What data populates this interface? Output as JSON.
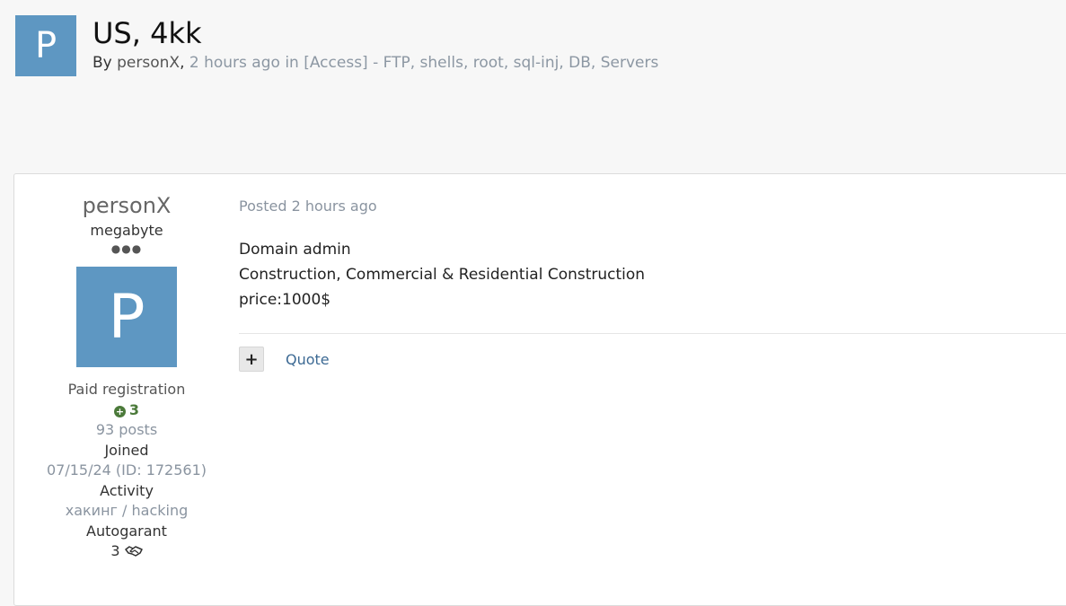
{
  "topic": {
    "avatar_letter": "P",
    "title": "US, 4kk",
    "by_label": "By",
    "author": "personX",
    "separator": ",",
    "time": "2 hours ago",
    "in_label": "in",
    "forum": "[Access] - FTP, shells, root, sql-inj, DB, Servers"
  },
  "author_panel": {
    "name": "personX",
    "rank": "megabyte",
    "rank_dots": "●●●",
    "avatar_letter": "P",
    "group": "Paid registration",
    "reputation": "3",
    "posts": "93 posts",
    "joined_label": "Joined",
    "joined_value": "07/15/24 (ID: 172561)",
    "activity_label": "Activity",
    "activity_value": "хакинг / hacking",
    "autogarant_label": "Autogarant",
    "autogarant_value": "3"
  },
  "post": {
    "posted": "Posted 2 hours ago",
    "lines": [
      "Domain admin",
      "Construction, Commercial & Residential Construction",
      "price:1000$"
    ],
    "plus_label": "+",
    "quote_label": "Quote"
  },
  "icons": {
    "reputation": "plus-circle-icon",
    "autogarant": "handshake-icon"
  },
  "colors": {
    "avatar_bg": "#5e97c2",
    "link": "#3d6a94",
    "meta_grey": "#8a94a0",
    "reputation_green": "#4b7a3a"
  }
}
